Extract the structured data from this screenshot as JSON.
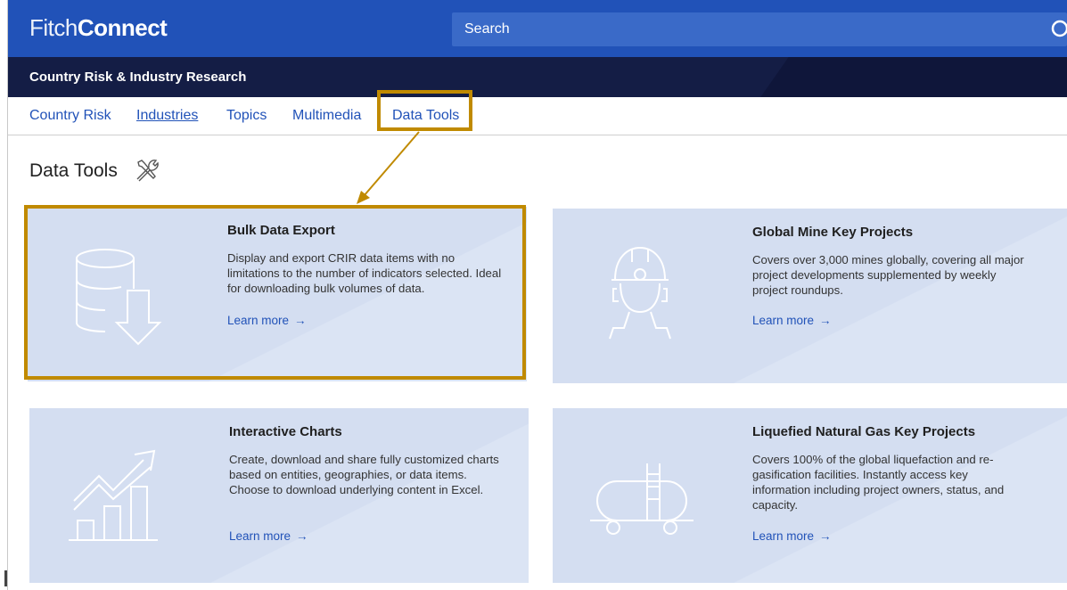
{
  "header": {
    "logo_part1": "Fitch",
    "logo_part2": "Connect",
    "search_placeholder": "Search"
  },
  "subheader": {
    "title": "Country Risk & Industry Research"
  },
  "nav": {
    "items": [
      {
        "label": "Country Risk"
      },
      {
        "label": "Industries"
      },
      {
        "label": "Topics"
      },
      {
        "label": "Multimedia"
      },
      {
        "label": "Data Tools"
      }
    ],
    "active": "Industries",
    "highlighted": "Data Tools"
  },
  "page": {
    "title": "Data Tools",
    "title_icon": "tools-icon"
  },
  "cards": [
    {
      "title": "Bulk Data Export",
      "description": "Display and export CRIR data items with no limitations to the number of indicators selected. Ideal for downloading bulk volumes of data.",
      "link": "Learn more",
      "icon": "database-download-icon",
      "highlighted": true
    },
    {
      "title": "Global Mine Key Projects",
      "description": "Covers over 3,000 mines globally, covering all major project developments supplemented by weekly project roundups.",
      "link": "Learn more",
      "icon": "miner-helmet-icon"
    },
    {
      "title": "Interactive Charts",
      "description": "Create, download and share fully customized charts based on entities, geographies, or data items. Choose to download underlying content in Excel.",
      "link": "Learn more",
      "icon": "bar-chart-trend-icon"
    },
    {
      "title": "Liquefied Natural Gas Key Projects",
      "description": "Covers 100% of the global liquefaction and re-gasification facilities. Instantly access key information including project owners, status, and capacity.",
      "link": "Learn more",
      "icon": "tank-car-icon"
    }
  ],
  "colors": {
    "brand_blue": "#2152b8",
    "navy": "#141d45",
    "highlight": "#c08a00",
    "card_bg": "#d4def1"
  }
}
